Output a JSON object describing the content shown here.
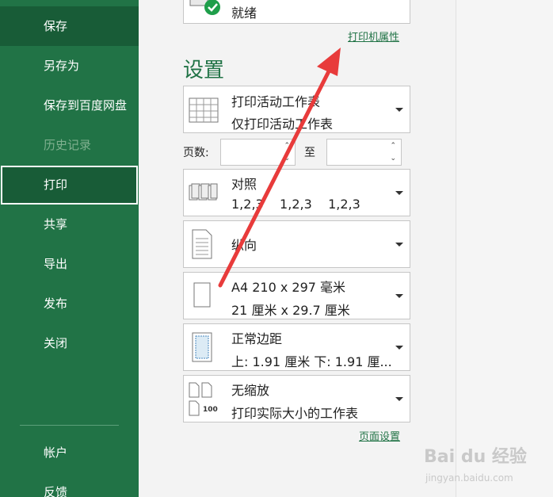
{
  "sidebar": {
    "items": [
      {
        "label": "保存"
      },
      {
        "label": "另存为"
      },
      {
        "label": "保存到百度网盘"
      },
      {
        "label": "历史记录"
      },
      {
        "label": "打印"
      },
      {
        "label": "共享"
      },
      {
        "label": "导出"
      },
      {
        "label": "发布"
      },
      {
        "label": "关闭"
      },
      {
        "label": "帐户"
      },
      {
        "label": "反馈"
      }
    ]
  },
  "printer": {
    "status": "就绪",
    "properties_link": "打印机属性"
  },
  "settings": {
    "heading": "设置",
    "print_what": {
      "line1": "打印活动工作表",
      "line2": "仅打印活动工作表"
    },
    "pages": {
      "label": "页数:",
      "to": "至",
      "from_value": "",
      "to_value": ""
    },
    "collate": {
      "line1": "对照",
      "line2": "1,2,3    1,2,3    1,2,3"
    },
    "orientation": {
      "line1": "纵向"
    },
    "paper": {
      "line1": "A4 210 x 297 毫米",
      "line2": "21 厘米 x 29.7 厘米"
    },
    "margins": {
      "line1": "正常边距",
      "line2": "上: 1.91 厘米 下: 1.91 厘..."
    },
    "scaling": {
      "line1": "无缩放",
      "line2": "打印实际大小的工作表",
      "icon_text": "100"
    },
    "page_setup_link": "页面设置"
  },
  "watermark": {
    "text": "Bai du 经验",
    "sub": "jingyan.baidu.com"
  },
  "colors": {
    "accent": "#217346",
    "sidebar_selected": "#185c37",
    "arrow": "#e83b3b"
  }
}
